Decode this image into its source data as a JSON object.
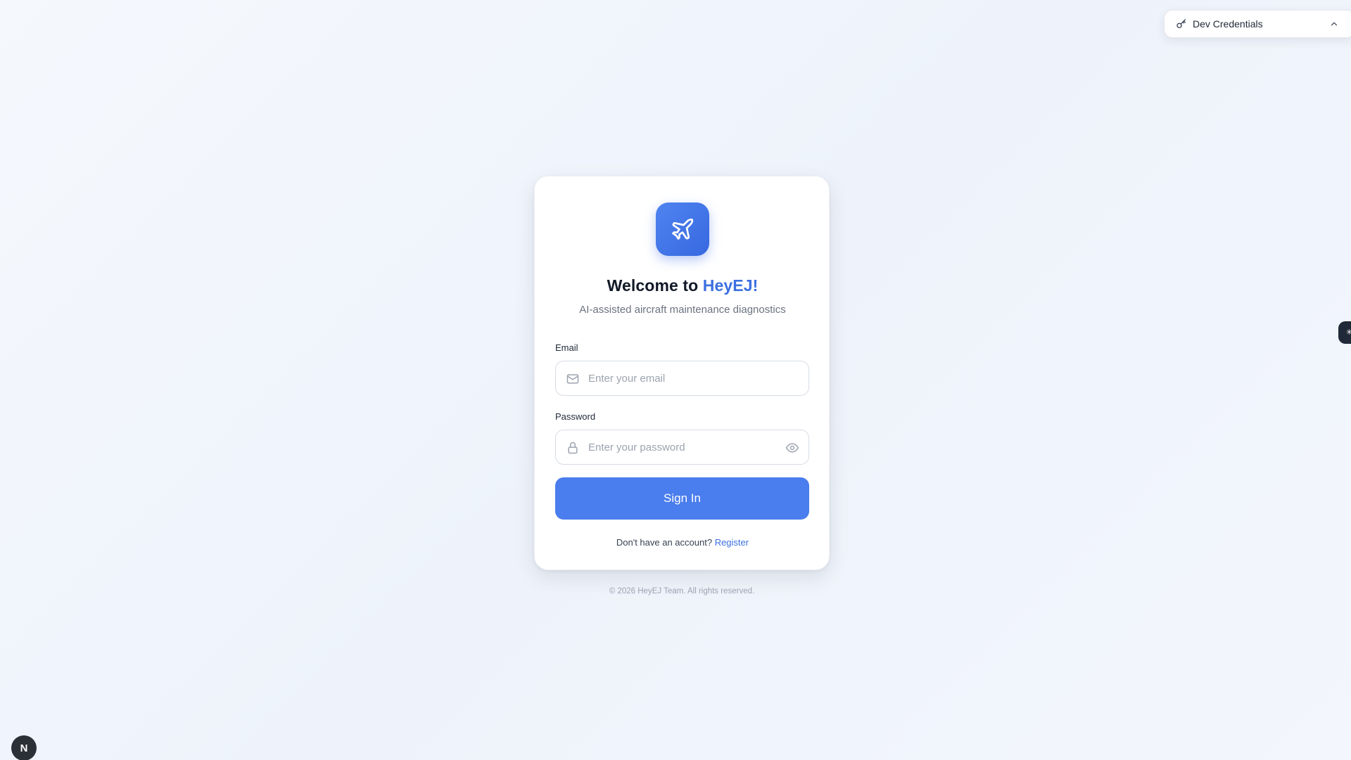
{
  "dev_credentials": {
    "label": "Dev Credentials",
    "key_icon": "key-icon",
    "toggle_icon": "chevron-up-icon"
  },
  "login_card": {
    "logo_icon": "airplane-icon",
    "title_prefix": "Welcome to ",
    "title_brand": "HeyEJ!",
    "subtitle": "AI-assisted aircraft maintenance diagnostics",
    "email": {
      "label": "Email",
      "placeholder": "Enter your email",
      "value": "",
      "icon": "mail-icon"
    },
    "password": {
      "label": "Password",
      "placeholder": "Enter your password",
      "value": "",
      "icon": "lock-icon",
      "toggle_icon": "eye-icon"
    },
    "signin_label": "Sign In",
    "no_account_text": "Don't have an account? ",
    "register_label": "Register"
  },
  "footer": {
    "copyright": "© 2026 HeyEJ Team. All rights reserved."
  },
  "next_badge": {
    "letter": "N"
  },
  "colors": {
    "accent": "#4a7ded",
    "brand_text": "#3b6fe0",
    "background": "#eef3fb"
  }
}
